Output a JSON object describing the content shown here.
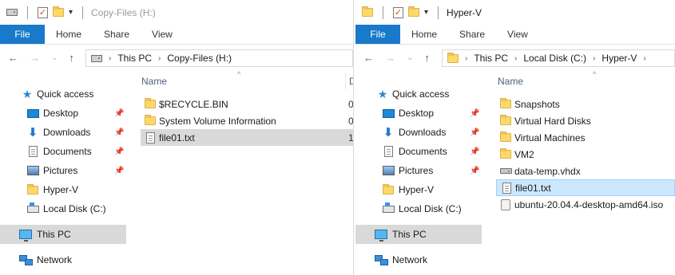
{
  "left_window": {
    "title": "Copy-Files (H:)",
    "ribbon": {
      "file": "File",
      "tabs": [
        "Home",
        "Share",
        "View"
      ]
    },
    "address": {
      "crumbs": [
        "This PC",
        "Copy-Files (H:)"
      ]
    },
    "column_name": "Name",
    "column_trunc": "D",
    "files": [
      {
        "name": "$RECYCLE.BIN",
        "icon": "folder-icon",
        "trail": "0"
      },
      {
        "name": "System Volume Information",
        "icon": "folder-icon",
        "trail": "0"
      },
      {
        "name": "file01.txt",
        "icon": "text-file-icon",
        "trail": "1",
        "selected": true
      }
    ]
  },
  "right_window": {
    "title": "Hyper-V",
    "ribbon": {
      "file": "File",
      "tabs": [
        "Home",
        "Share",
        "View"
      ]
    },
    "address": {
      "crumbs": [
        "This PC",
        "Local Disk (C:)",
        "Hyper-V"
      ]
    },
    "column_name": "Name",
    "files": [
      {
        "name": "Snapshots",
        "icon": "folder-icon"
      },
      {
        "name": "Virtual Hard Disks",
        "icon": "folder-icon"
      },
      {
        "name": "Virtual Machines",
        "icon": "folder-icon"
      },
      {
        "name": "VM2",
        "icon": "folder-icon"
      },
      {
        "name": "data-temp.vhdx",
        "icon": "virtual-disk-icon"
      },
      {
        "name": "file01.txt",
        "icon": "text-file-icon",
        "selected": true
      },
      {
        "name": "ubuntu-20.04.4-desktop-amd64.iso",
        "icon": "disc-image-icon"
      }
    ]
  },
  "nav_pane": {
    "quick_access": "Quick access",
    "items": [
      {
        "label": "Desktop",
        "icon": "desktop-icon",
        "pinned": true
      },
      {
        "label": "Downloads",
        "icon": "downloads-icon",
        "pinned": true
      },
      {
        "label": "Documents",
        "icon": "documents-icon",
        "pinned": true
      },
      {
        "label": "Pictures",
        "icon": "pictures-icon",
        "pinned": true
      },
      {
        "label": "Hyper-V",
        "icon": "folder-icon",
        "pinned": false
      },
      {
        "label": "Local Disk (C:)",
        "icon": "local-disk-icon",
        "pinned": false
      }
    ],
    "this_pc": "This PC",
    "network": "Network"
  },
  "colors": {
    "file_tab": "#1979ca",
    "selected_gray": "#d9d9d9",
    "selected_blue": "#cce8ff",
    "column_header": "#4c607a"
  }
}
